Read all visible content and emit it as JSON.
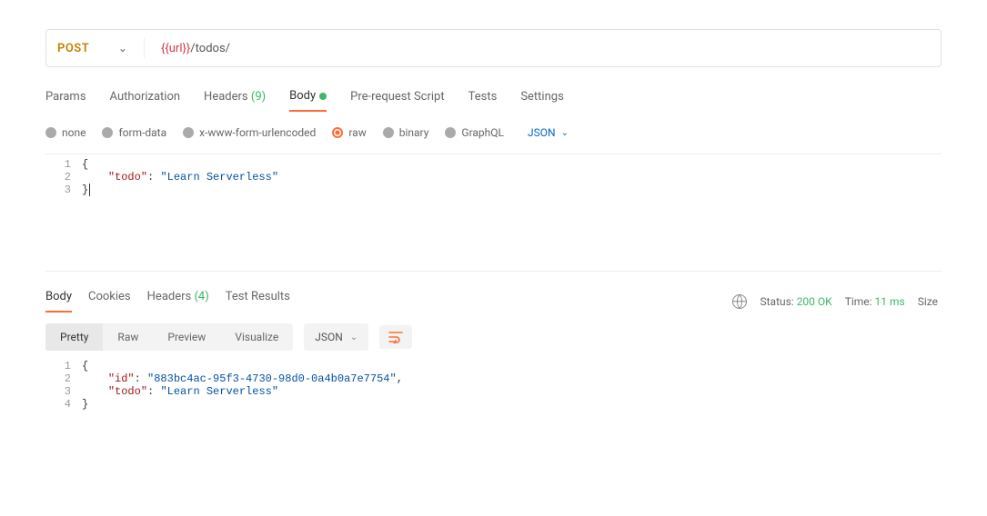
{
  "request": {
    "method": "POST",
    "url_variable": "{{url}}",
    "url_path": "/todos/"
  },
  "request_tabs": {
    "params": "Params",
    "auth": "Authorization",
    "headers_label": "Headers",
    "headers_count": "(9)",
    "body": "Body",
    "prerequest": "Pre-request Script",
    "tests": "Tests",
    "settings": "Settings"
  },
  "body_types": {
    "none": "none",
    "formdata": "form-data",
    "xwww": "x-www-form-urlencoded",
    "raw": "raw",
    "binary": "binary",
    "graphql": "GraphQL",
    "format": "JSON"
  },
  "request_body": {
    "lines": [
      {
        "n": "1",
        "content": "{"
      },
      {
        "n": "2",
        "content": "    \"todo\": \"Learn Serverless\""
      },
      {
        "n": "3",
        "content": "}"
      }
    ],
    "key": "\"todo\"",
    "value": "\"Learn Serverless\""
  },
  "response_tabs": {
    "body": "Body",
    "cookies": "Cookies",
    "headers_label": "Headers",
    "headers_count": "(4)",
    "tests": "Test Results"
  },
  "response_meta": {
    "status_label": "Status:",
    "status_value": "200 OK",
    "time_label": "Time:",
    "time_value": "11 ms",
    "size_label": "Size"
  },
  "view_modes": {
    "pretty": "Pretty",
    "raw": "Raw",
    "preview": "Preview",
    "visualize": "Visualize",
    "format": "JSON"
  },
  "response_body": {
    "lines": [
      "1",
      "2",
      "3",
      "4"
    ],
    "key_id": "\"id\"",
    "val_id": "\"883bc4ac-95f3-4730-98d0-0a4b0a7e7754\"",
    "key_todo": "\"todo\"",
    "val_todo": "\"Learn Serverless\""
  }
}
